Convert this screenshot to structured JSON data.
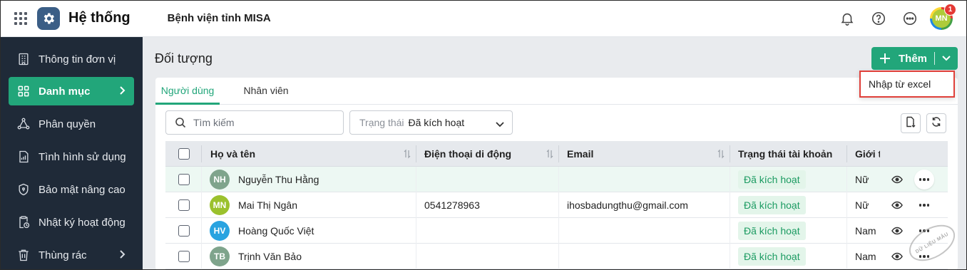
{
  "app": {
    "name": "Hệ thống",
    "organization": "Bệnh viện tỉnh MISA",
    "user_initials": "MN",
    "notification_count": "1"
  },
  "sidebar": {
    "items": [
      {
        "label": "Thông tin đơn vị",
        "icon": "building-icon"
      },
      {
        "label": "Danh mục",
        "icon": "grid-icon",
        "active": true,
        "has_submenu": true
      },
      {
        "label": "Phân quyền",
        "icon": "share-nodes-icon"
      },
      {
        "label": "Tình hình sử dụng",
        "icon": "document-chart-icon"
      },
      {
        "label": "Bảo mật nâng cao",
        "icon": "shield-icon"
      },
      {
        "label": "Nhật ký hoạt động",
        "icon": "clipboard-clock-icon"
      },
      {
        "label": "Thùng rác",
        "icon": "trash-icon",
        "has_submenu": true
      }
    ]
  },
  "main": {
    "title": "Đối tượng",
    "add_button": "Thêm",
    "dropdown_item": "Nhập từ excel",
    "tabs": [
      {
        "label": "Người dùng",
        "active": true
      },
      {
        "label": "Nhân viên",
        "active": false
      }
    ],
    "search": {
      "placeholder": "Tìm kiếm"
    },
    "status_filter": {
      "label": "Trạng thái",
      "value": "Đã kích hoạt"
    }
  },
  "table": {
    "columns": [
      "Họ và tên",
      "Điện thoại di động",
      "Email",
      "Trạng thái tài khoản",
      "Giới t"
    ],
    "rows": [
      {
        "initials": "NH",
        "avatar_color": "#7fa48c",
        "name": "Nguyễn Thu Hằng",
        "phone": "",
        "email": "",
        "status": "Đã kích hoạt",
        "gender": "Nữ",
        "highlighted": true
      },
      {
        "initials": "MN",
        "avatar_color": "#9bc12d",
        "name": "Mai Thị Ngân",
        "phone": "0541278963",
        "email": "ihosbadungthu@gmail.com",
        "status": "Đã kích hoạt",
        "gender": "Nữ",
        "highlighted": false
      },
      {
        "initials": "HV",
        "avatar_color": "#29a3e0",
        "name": "Hoàng Quốc Việt",
        "phone": "",
        "email": "",
        "status": "Đã kích hoạt",
        "gender": "Nam",
        "highlighted": false
      },
      {
        "initials": "TB",
        "avatar_color": "#7fa48c",
        "name": "Trịnh Văn Bảo",
        "phone": "",
        "email": "",
        "status": "Đã kích hoạt",
        "gender": "Nam",
        "highlighted": false
      }
    ]
  },
  "colors": {
    "accent": "#22a67a",
    "sidebar_bg": "#1f2a38",
    "highlight_border": "#e0403a"
  },
  "watermark": "DỮ LIỆU MẪU"
}
